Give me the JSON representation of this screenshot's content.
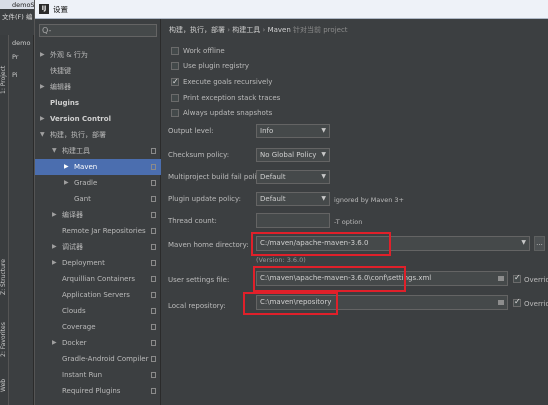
{
  "ide": {
    "window_title": "demoS",
    "menu_file": "文件(F)",
    "menu_edit": "编",
    "tree_items": [
      "demo",
      "Pr",
      "Pi"
    ],
    "side_tabs": {
      "project": "1: Project",
      "structure": "Z: Structure",
      "favorites": "2: Favorites",
      "web": "Web"
    }
  },
  "dialog": {
    "title": "设置",
    "app_icon_text": "IJ"
  },
  "search": {
    "placeholder": "Q-"
  },
  "tree": [
    {
      "label": "外观 & 行为",
      "arrow": "▶",
      "bold": false,
      "level": 0
    },
    {
      "label": "快捷键",
      "arrow": "",
      "bold": false,
      "level": 0
    },
    {
      "label": "编辑器",
      "arrow": "▶",
      "bold": false,
      "level": 0
    },
    {
      "label": "Plugins",
      "arrow": "",
      "bold": true,
      "level": 0
    },
    {
      "label": "Version Control",
      "arrow": "▶",
      "bold": true,
      "level": 0
    },
    {
      "label": "构建，执行，部署",
      "arrow": "▼",
      "bold": false,
      "level": 0
    },
    {
      "label": "构建工具",
      "arrow": "▼",
      "bold": false,
      "level": 1
    },
    {
      "label": "Maven",
      "arrow": "▶",
      "bold": false,
      "level": 2,
      "selected": true
    },
    {
      "label": "Gradle",
      "arrow": "▶",
      "bold": false,
      "level": 2
    },
    {
      "label": "Gant",
      "arrow": "",
      "bold": false,
      "level": 2
    },
    {
      "label": "编译器",
      "arrow": "▶",
      "bold": false,
      "level": 1
    },
    {
      "label": "Remote Jar Repositories",
      "arrow": "",
      "bold": false,
      "level": 1
    },
    {
      "label": "调试器",
      "arrow": "▶",
      "bold": false,
      "level": 1
    },
    {
      "label": "Deployment",
      "arrow": "▶",
      "bold": false,
      "level": 1
    },
    {
      "label": "Arquillian Containers",
      "arrow": "",
      "bold": false,
      "level": 1
    },
    {
      "label": "Application Servers",
      "arrow": "",
      "bold": false,
      "level": 1
    },
    {
      "label": "Clouds",
      "arrow": "",
      "bold": false,
      "level": 1
    },
    {
      "label": "Coverage",
      "arrow": "",
      "bold": false,
      "level": 1
    },
    {
      "label": "Docker",
      "arrow": "▶",
      "bold": false,
      "level": 1
    },
    {
      "label": "Gradle-Android Compiler",
      "arrow": "",
      "bold": false,
      "level": 1
    },
    {
      "label": "Instant Run",
      "arrow": "",
      "bold": false,
      "level": 1
    },
    {
      "label": "Required Plugins",
      "arrow": "",
      "bold": false,
      "level": 1
    }
  ],
  "breadcrumb": {
    "part1": "构建，执行，部署",
    "sep": "›",
    "part2": "构建工具",
    "part3": "Maven",
    "note": "针对当前 project"
  },
  "options": {
    "work_offline": {
      "label": "Work offline",
      "checked": false
    },
    "use_plugin_registry": {
      "label": "Use plugin registry",
      "checked": false
    },
    "execute_goals_recursively": {
      "label": "Execute goals recursively",
      "checked": true
    },
    "print_exception_stack_traces": {
      "label": "Print exception stack traces",
      "checked": false
    },
    "always_update_snapshots": {
      "label": "Always update snapshots",
      "checked": false
    }
  },
  "fields": {
    "output_level": {
      "label": "Output level:",
      "value": "Info"
    },
    "checksum_policy": {
      "label": "Checksum policy:",
      "value": "No Global Policy"
    },
    "multiproject_fail_policy": {
      "label": "Multiproject build fail policy:",
      "value": "Default"
    },
    "plugin_update_policy": {
      "label": "Plugin update policy:",
      "value": "Default",
      "hint": "ignored by Maven 3+"
    },
    "thread_count": {
      "label": "Thread count:",
      "value": "",
      "hint": "-T option"
    },
    "maven_home": {
      "label": "Maven home directory:",
      "value": "C:/maven/apache-maven-3.6.0",
      "version": "(Version: 3.6.0)",
      "browse": "..."
    },
    "user_settings": {
      "label": "User settings file:",
      "value": "C:\\maven\\apache-maven-3.6.0\\conf\\settings.xml",
      "override_label": "Override",
      "override_checked": true
    },
    "local_repository": {
      "label": "Local repository:",
      "value": "C:\\maven\\repository",
      "override_label": "Override",
      "override_checked": true
    }
  },
  "colors": {
    "selection": "#4b6eaf",
    "highlight_box": "#e0202a",
    "panel": "#3c3f41"
  }
}
